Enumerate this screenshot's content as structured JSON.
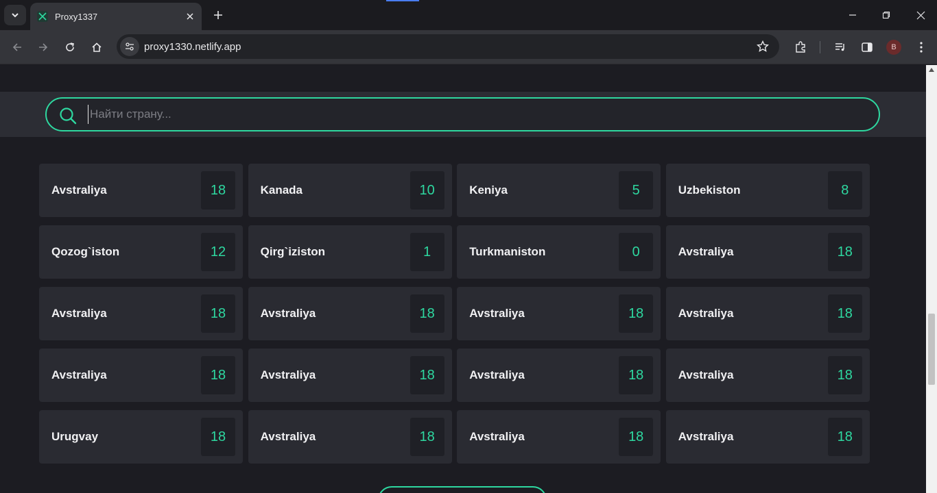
{
  "browser": {
    "tab_title": "Proxy1337",
    "url": "proxy1330.netlify.app",
    "profile_initial": "B"
  },
  "search": {
    "placeholder": "Найти страну..."
  },
  "countries": [
    {
      "name": "Avstraliya",
      "count": "18"
    },
    {
      "name": "Kanada",
      "count": "10"
    },
    {
      "name": "Keniya",
      "count": "5"
    },
    {
      "name": "Uzbekiston",
      "count": "8"
    },
    {
      "name": "Qozog`iston",
      "count": "12"
    },
    {
      "name": "Qirg`iziston",
      "count": "1"
    },
    {
      "name": "Turkmaniston",
      "count": "0"
    },
    {
      "name": "Avstraliya",
      "count": "18"
    },
    {
      "name": "Avstraliya",
      "count": "18"
    },
    {
      "name": "Avstraliya",
      "count": "18"
    },
    {
      "name": "Avstraliya",
      "count": "18"
    },
    {
      "name": "Avstraliya",
      "count": "18"
    },
    {
      "name": "Avstraliya",
      "count": "18"
    },
    {
      "name": "Avstraliya",
      "count": "18"
    },
    {
      "name": "Avstraliya",
      "count": "18"
    },
    {
      "name": "Avstraliya",
      "count": "18"
    },
    {
      "name": "Urugvay",
      "count": "18"
    },
    {
      "name": "Avstraliya",
      "count": "18"
    },
    {
      "name": "Avstraliya",
      "count": "18"
    },
    {
      "name": "Avstraliya",
      "count": "18"
    }
  ],
  "colors": {
    "accent": "#2ed8a0",
    "background": "#1c1c22",
    "card": "#2a2b32"
  }
}
